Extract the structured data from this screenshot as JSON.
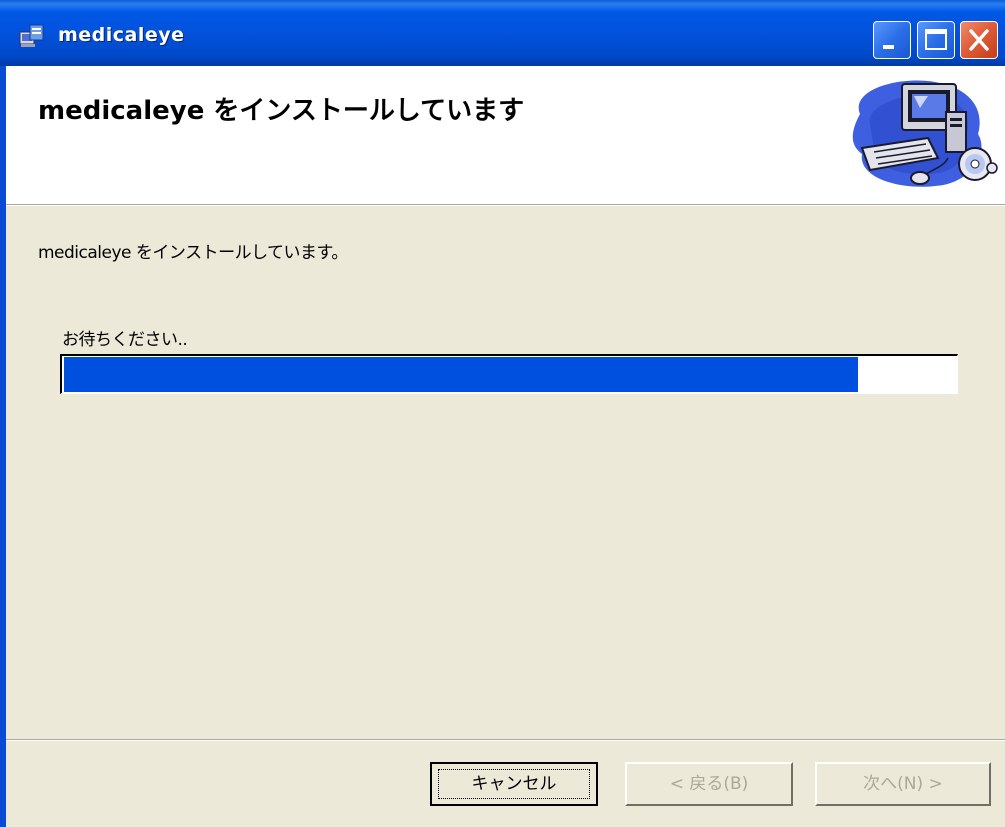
{
  "window": {
    "title": "medicaleye"
  },
  "header": {
    "title": "medicaleye をインストールしています"
  },
  "body": {
    "status_text": "medicaleye をインストールしています。",
    "wait_text": "お待ちください..",
    "progress_fraction": 0.89
  },
  "buttons": {
    "cancel": "キャンセル",
    "back": "< 戻る(B)",
    "next": "次へ(N) >"
  },
  "colors": {
    "titlebar": "#0054e3",
    "progress_fill": "#0050e0",
    "close_button": "#d9532c",
    "dialog_bg": "#ece9d8"
  },
  "icons": {
    "titlebar": "installer-icon",
    "header": "computer-cd-icon"
  }
}
